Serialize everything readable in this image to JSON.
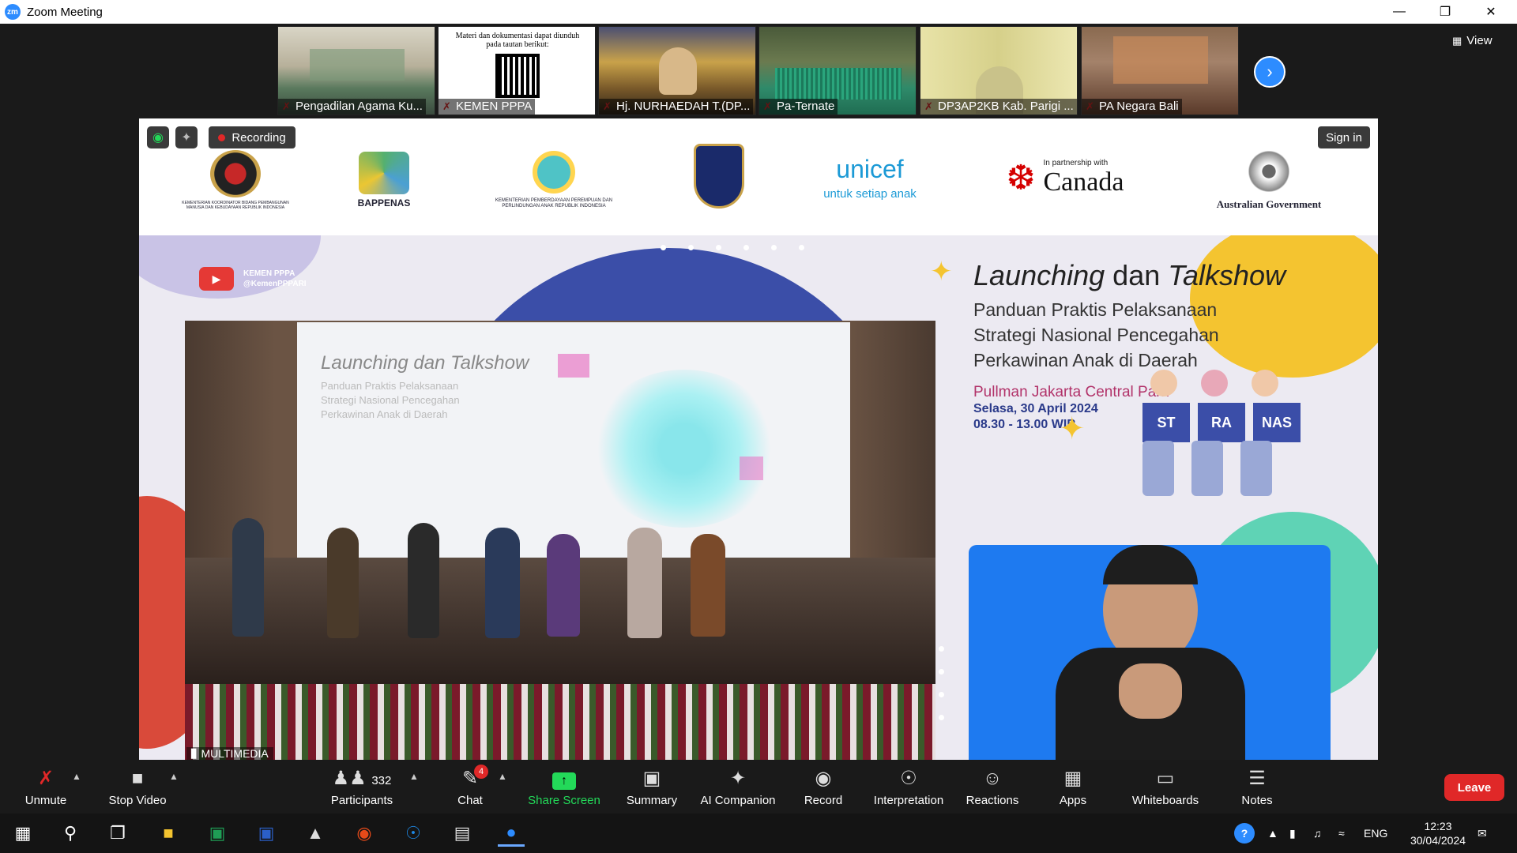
{
  "window": {
    "title": "Zoom Meeting",
    "logo_text": "zm"
  },
  "view_label": "View",
  "thumbnails": [
    {
      "name": "Pengadilan Agama Ku..."
    },
    {
      "name": "KEMEN PPPA",
      "note": "Materi dan dokumentasi dapat diunduh pada tautan berikut:"
    },
    {
      "name": "Hj. NURHAEDAH T.(DP..."
    },
    {
      "name": "Pa-Ternate"
    },
    {
      "name": "DP3AP2KB Kab. Parigi ..."
    },
    {
      "name": "PA Negara Bali"
    }
  ],
  "share": {
    "recording_label": "Recording",
    "sign_in_label": "Sign in",
    "multimedia_label": "MULTIMEDIA",
    "logos": {
      "bappenas": "BAPPENAS",
      "kemenko": "KEMENTERIAN KOORDINATOR BIDANG PEMBANGUNAN MANUSIA DAN KEBUDAYAAN REPUBLIK INDONESIA",
      "kemenpppa": "KEMENTERIAN PEMBERDAYAAN PEREMPUAN DAN PERLINDUNGAN ANAK REPUBLIK INDONESIA",
      "unicef": "unicef",
      "unicef_sub": "untuk setiap anak",
      "canada_pre": "In partnership with",
      "canada": "Canada",
      "australia": "Australian Government"
    },
    "youtube": {
      "line1": "KEMEN PPPA",
      "line2": "@KemenPPPARI"
    },
    "event": {
      "title_a": "Launching",
      "title_b": "dan",
      "title_c": "Talkshow",
      "subtitle_1": "Panduan Praktis Pelaksanaan",
      "subtitle_2": "Strategi Nasional Pencegahan",
      "subtitle_3": "Perkawinan Anak di Daerah",
      "venue": "Pullman Jakarta Central Park",
      "date": "Selasa, 30 April 2024",
      "time": "08.30 - 13.00 WIB",
      "boards": [
        "ST",
        "RA",
        "NAS"
      ]
    },
    "screen_text": {
      "title": "Launching dan Talkshow",
      "sub1": "Panduan Praktis Pelaksanaan",
      "sub2": "Strategi Nasional Pencegahan",
      "sub3": "Perkawinan Anak di Daerah"
    }
  },
  "toolbar": {
    "unmute": "Unmute",
    "stop_video": "Stop Video",
    "participants": "Participants",
    "participants_count": "332",
    "chat": "Chat",
    "chat_badge": "4",
    "share_screen": "Share Screen",
    "summary": "Summary",
    "ai_companion": "AI Companion",
    "record": "Record",
    "interpretation": "Interpretation",
    "reactions": "Reactions",
    "apps": "Apps",
    "whiteboards": "Whiteboards",
    "notes": "Notes",
    "leave": "Leave"
  },
  "taskbar": {
    "lang": "ENG",
    "time": "12:23",
    "date": "30/04/2024"
  },
  "colors": {
    "zoom_blue": "#2d8cff",
    "leave_red": "#e02828",
    "share_green": "#23d959"
  }
}
